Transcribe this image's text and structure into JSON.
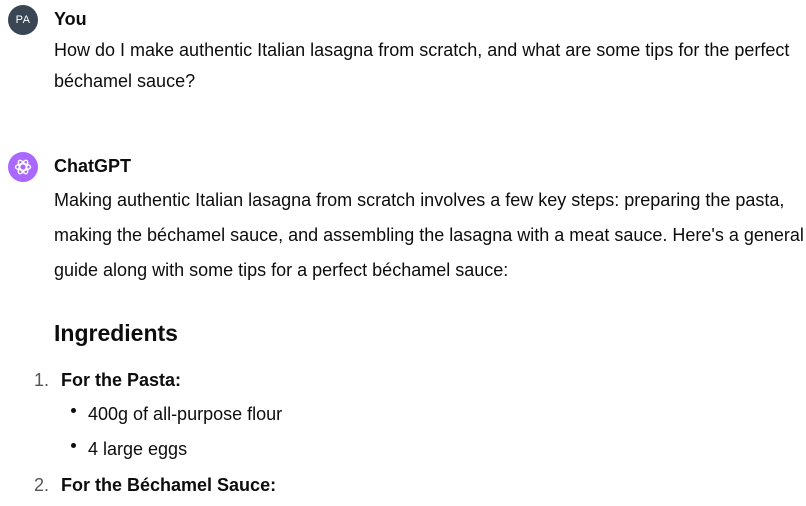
{
  "user": {
    "avatar_initials": "PA",
    "name": "You",
    "message": "How do I make authentic Italian lasagna from scratch, and what are some tips for the perfect béchamel sauce?"
  },
  "assistant": {
    "name": "ChatGPT",
    "avatar_icon": "openai-logo-icon",
    "intro": "Making authentic Italian lasagna from scratch involves a few key steps: preparing the pasta, making the béchamel sauce, and assembling the lasagna with a meat sauce. Here's a general guide along with some tips for a perfect béchamel sauce:",
    "section_heading": "Ingredients",
    "list": [
      {
        "number": "1.",
        "title": "For the Pasta:",
        "items": [
          "400g of all-purpose flour",
          "4 large eggs"
        ]
      },
      {
        "number": "2.",
        "title": "For the Béchamel Sauce:",
        "items": []
      }
    ]
  },
  "colors": {
    "user_avatar": "#3a4654",
    "assistant_avatar": "#ab68ff"
  }
}
